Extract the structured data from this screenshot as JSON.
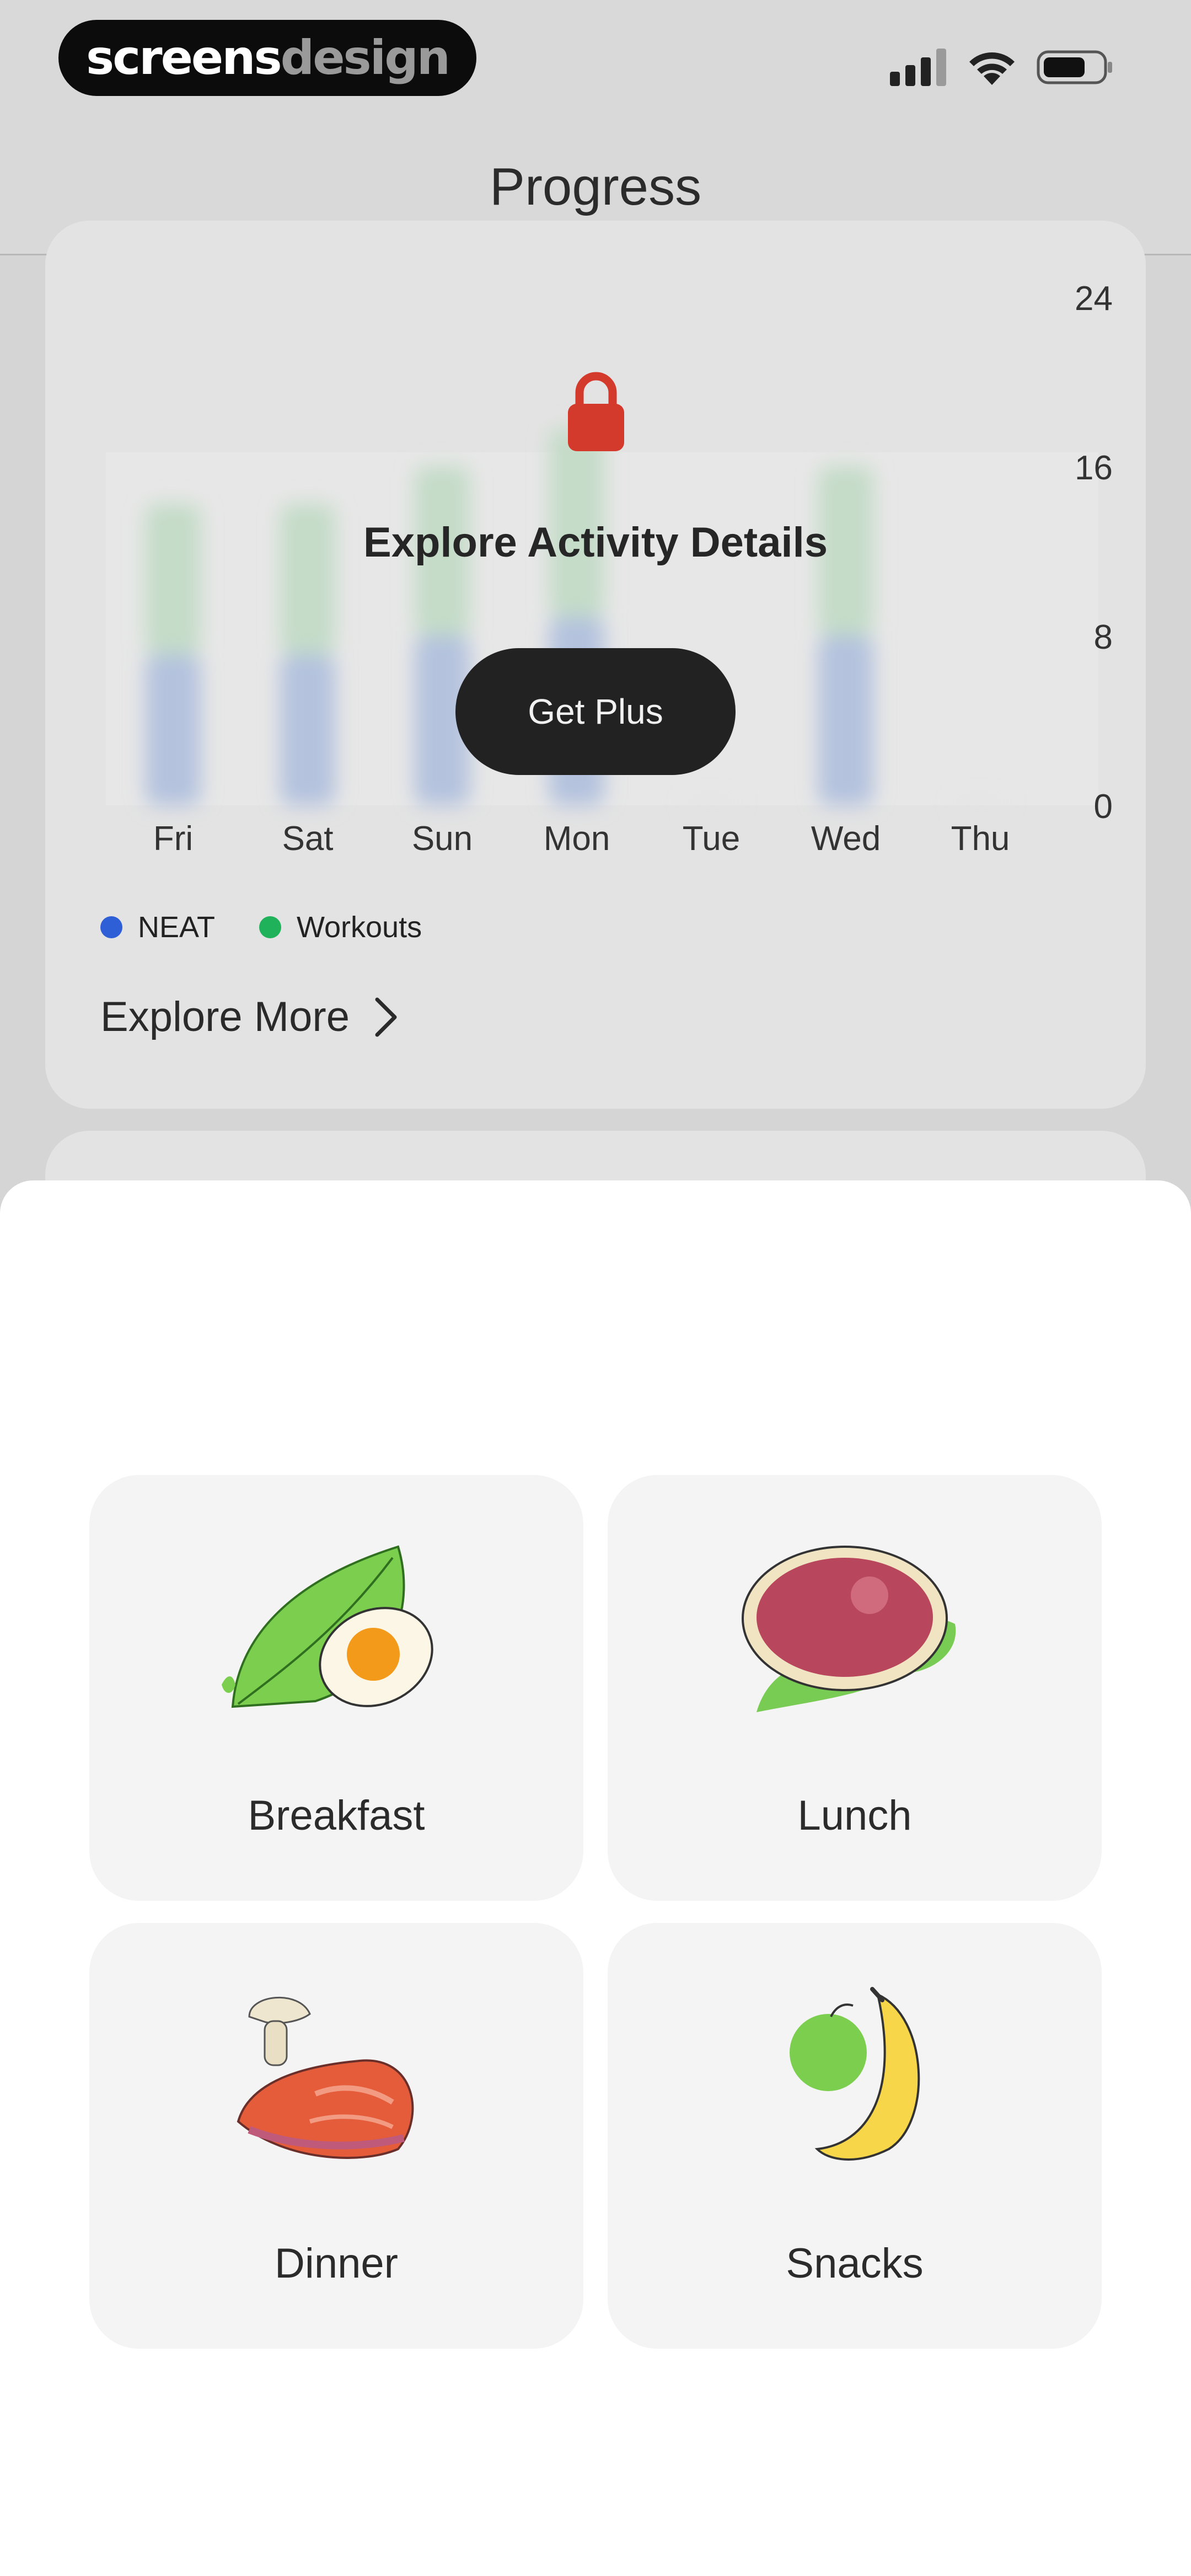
{
  "brand": {
    "part1": "screens",
    "part2": "design"
  },
  "header": {
    "title": "Progress"
  },
  "activity_card": {
    "overlay_title": "Explore Activity Details",
    "cta_label": "Get Plus",
    "explore_more_label": "Explore More",
    "legend": [
      {
        "label": "NEAT",
        "color": "#2f5fd6"
      },
      {
        "label": "Workouts",
        "color": "#1fb25a"
      }
    ]
  },
  "chart_data": {
    "type": "bar",
    "stacked": true,
    "categories": [
      "Fri",
      "Sat",
      "Sun",
      "Mon",
      "Tue",
      "Wed",
      "Thu"
    ],
    "series": [
      {
        "name": "NEAT",
        "values": [
          8,
          8,
          9,
          10,
          0,
          9,
          0
        ],
        "color": "#b4c2de"
      },
      {
        "name": "Workouts",
        "values": [
          8,
          8,
          9,
          10,
          0,
          9,
          0
        ],
        "color": "#c4dcc8"
      }
    ],
    "y_ticks": [
      "24",
      "16",
      "8",
      "0"
    ],
    "ylim": [
      0,
      24
    ],
    "blurred": true
  },
  "meals": [
    {
      "label": "Breakfast",
      "icon": "egg-leaf-icon"
    },
    {
      "label": "Lunch",
      "icon": "steak-icon"
    },
    {
      "label": "Dinner",
      "icon": "salmon-icon"
    },
    {
      "label": "Snacks",
      "icon": "fruit-icon"
    }
  ]
}
